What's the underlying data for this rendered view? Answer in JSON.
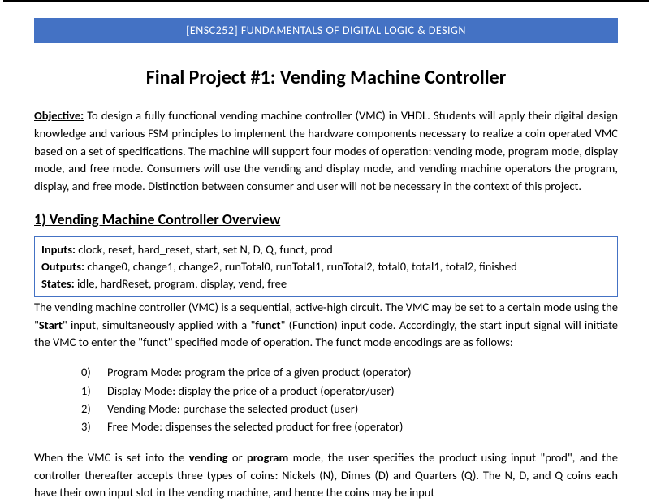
{
  "header": {
    "bar": "[ENSC252] FUNDAMENTALS OF DIGITAL LOGIC & DESIGN"
  },
  "title": "Final Project #1: Vending Machine Controller",
  "objective": {
    "label": "Objective:",
    "text": " To design a fully functional vending machine controller (VMC) in VHDL. Students will apply their digital design knowledge and various FSM principles to implement the hardware components necessary to realize a coin operated VMC based on a set of specifications. The machine will support four modes of operation: vending mode, program mode, display mode, and free mode. Consumers will use the vending and display mode, and vending machine operators the program, display, and free mode. Distinction between consumer and user will not be necessary in the context of this project."
  },
  "section1": {
    "heading": "1) Vending Machine Controller Overview",
    "io": {
      "inputs_label": "Inputs:",
      "inputs": " clock, reset, hard_reset, start, set N, D, Q, funct, prod",
      "outputs_label": "Outputs:",
      "outputs": " change0, change1, change2, runTotal0, runTotal1, runTotal2, total0, total1, total2, finished",
      "states_label": "States:",
      "states": " idle, hardReset, program, display, vend, free"
    },
    "overview": {
      "p1a": "The vending machine controller (VMC) is a sequential, active-high circuit. The VMC may be set to a certain mode using the \"",
      "bold1": "Start",
      "p1b": "\" input, simultaneously applied with a \"",
      "bold2": "funct",
      "p1c": "\" (Function) input code. Accordingly, the start input signal will initiate the VMC to enter the \"funct\" specified mode of operation. The funct mode encodings are as follows:"
    },
    "modes": [
      {
        "num": "0)",
        "text": "Program Mode: program the price of a given product (operator)"
      },
      {
        "num": "1)",
        "text": "Display Mode: display the price of a product (operator/user)"
      },
      {
        "num": "2)",
        "text": "Vending Mode: purchase the selected product (user)"
      },
      {
        "num": "3)",
        "text": "Free Mode: dispenses the selected product for free (operator)"
      }
    ],
    "final": {
      "p2a": "When the VMC is set into the ",
      "bold1": "vending",
      "p2b": " or ",
      "bold2": "program",
      "p2c": " mode, the user specifies the product using input \"prod\", and the controller thereafter accepts three types of coins: Nickels (N), Dimes (D) and Quarters (Q). The N, D, and Q coins each have their own input slot in the vending machine, and hence the coins may be input"
    }
  }
}
